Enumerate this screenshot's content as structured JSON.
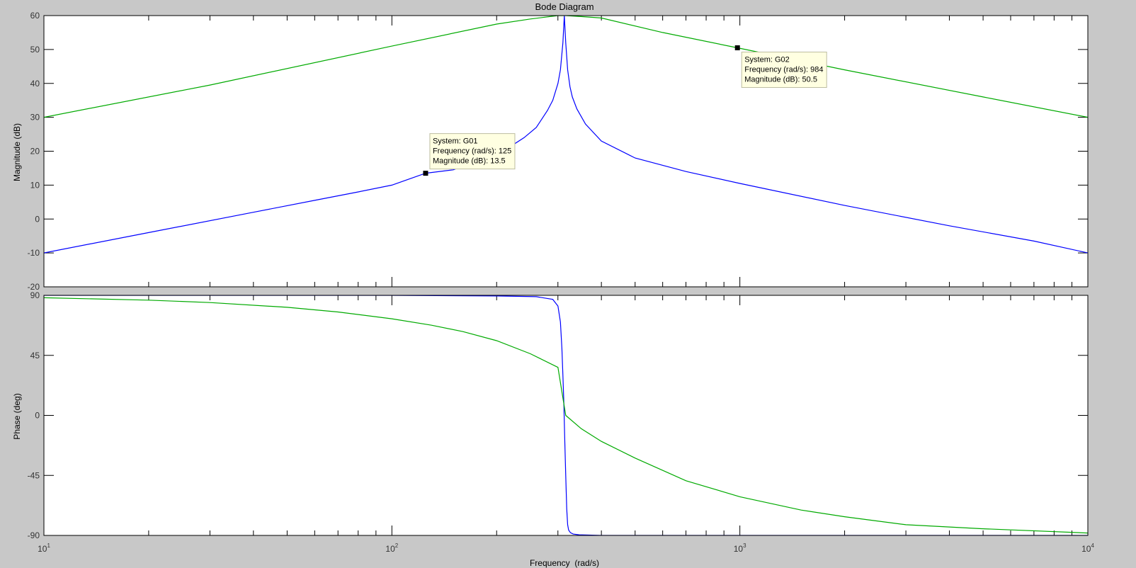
{
  "figure": {
    "background": "#c8c8c8",
    "axes_background": "#ffffff",
    "axis_color": "#000000",
    "tick_label_color": "#333333"
  },
  "chart_data": [
    {
      "type": "line",
      "title": "Bode Diagram",
      "ylabel": "Magnitude (dB)",
      "xscale": "log",
      "xlim": [
        10,
        10000
      ],
      "ylim": [
        -20,
        60
      ],
      "yticks": [
        "-20",
        "-10",
        "0",
        "10",
        "20",
        "30",
        "40",
        "50",
        "60"
      ],
      "grid": false,
      "series": [
        {
          "name": "G01",
          "color": "#0000ff",
          "x": [
            10,
            20,
            40,
            60,
            80,
            100,
            125,
            150,
            180,
            200,
            220,
            240,
            260,
            280,
            290,
            300,
            305,
            310,
            313,
            316,
            320,
            325,
            330,
            340,
            360,
            400,
            500,
            700,
            1000,
            2000,
            4000,
            7000,
            10000
          ],
          "y": [
            -10,
            -4,
            2,
            5.5,
            8,
            10,
            13.5,
            14.5,
            17.5,
            19.5,
            21.5,
            24,
            27,
            32,
            35,
            40,
            44,
            52,
            60,
            52,
            44,
            39,
            36,
            32.5,
            28,
            23,
            18,
            14,
            10.5,
            4,
            -2,
            -6.5,
            -10
          ]
        },
        {
          "name": "G02",
          "color": "#00aa00",
          "x": [
            10,
            30,
            100,
            200,
            250,
            300,
            316,
            350,
            400,
            600,
            984,
            2000,
            5000,
            10000
          ],
          "y": [
            30,
            39.5,
            51,
            57.5,
            59,
            60,
            60,
            59.7,
            59.3,
            55,
            50.5,
            44,
            36,
            30
          ]
        }
      ],
      "annotations": [
        {
          "series": "G01",
          "x": 125,
          "y": 13.5,
          "lines": [
            "System: G01",
            "Frequency (rad/s): 125",
            "Magnitude (dB): 13.5"
          ]
        },
        {
          "series": "G02",
          "x": 984,
          "y": 50.5,
          "lines": [
            "System: G02",
            "Frequency (rad/s): 984",
            "Magnitude (dB): 50.5"
          ]
        }
      ]
    },
    {
      "type": "line",
      "ylabel": "Phase (deg)",
      "xlabel": "Frequency  (rad/s)",
      "xscale": "log",
      "xlim": [
        10,
        10000
      ],
      "ylim": [
        -90,
        90
      ],
      "yticks": [
        "-90",
        "-45",
        "0",
        "45",
        "90"
      ],
      "xticks": [
        {
          "value": 10,
          "base": "10",
          "exp": "1"
        },
        {
          "value": 100,
          "base": "10",
          "exp": "2"
        },
        {
          "value": 1000,
          "base": "10",
          "exp": "3"
        },
        {
          "value": 10000,
          "base": "10",
          "exp": "4"
        }
      ],
      "grid": false,
      "series": [
        {
          "name": "G01",
          "color": "#0000ff",
          "x": [
            10,
            100,
            200,
            260,
            290,
            300,
            305,
            308,
            310,
            312,
            314,
            316,
            318,
            320,
            322,
            326,
            332,
            345,
            400,
            10000
          ],
          "y": [
            90,
            90,
            89.5,
            89,
            87,
            82,
            70,
            50,
            30,
            10,
            -20,
            -45,
            -70,
            -82,
            -86,
            -88,
            -89,
            -89.5,
            -90,
            -90
          ]
        },
        {
          "name": "G02",
          "color": "#00aa00",
          "x": [
            10,
            20,
            30,
            50,
            70,
            100,
            130,
            160,
            200,
            250,
            300,
            316,
            350,
            400,
            500,
            700,
            1000,
            1500,
            2000,
            3000,
            5000,
            10000
          ],
          "y": [
            88.2,
            86.4,
            84.6,
            81,
            77.5,
            72.4,
            67.6,
            62.8,
            56,
            46.2,
            36,
            0,
            -10,
            -19.5,
            -32,
            -49,
            -61,
            -71,
            -76,
            -82,
            -85,
            -88.2
          ]
        }
      ]
    }
  ]
}
